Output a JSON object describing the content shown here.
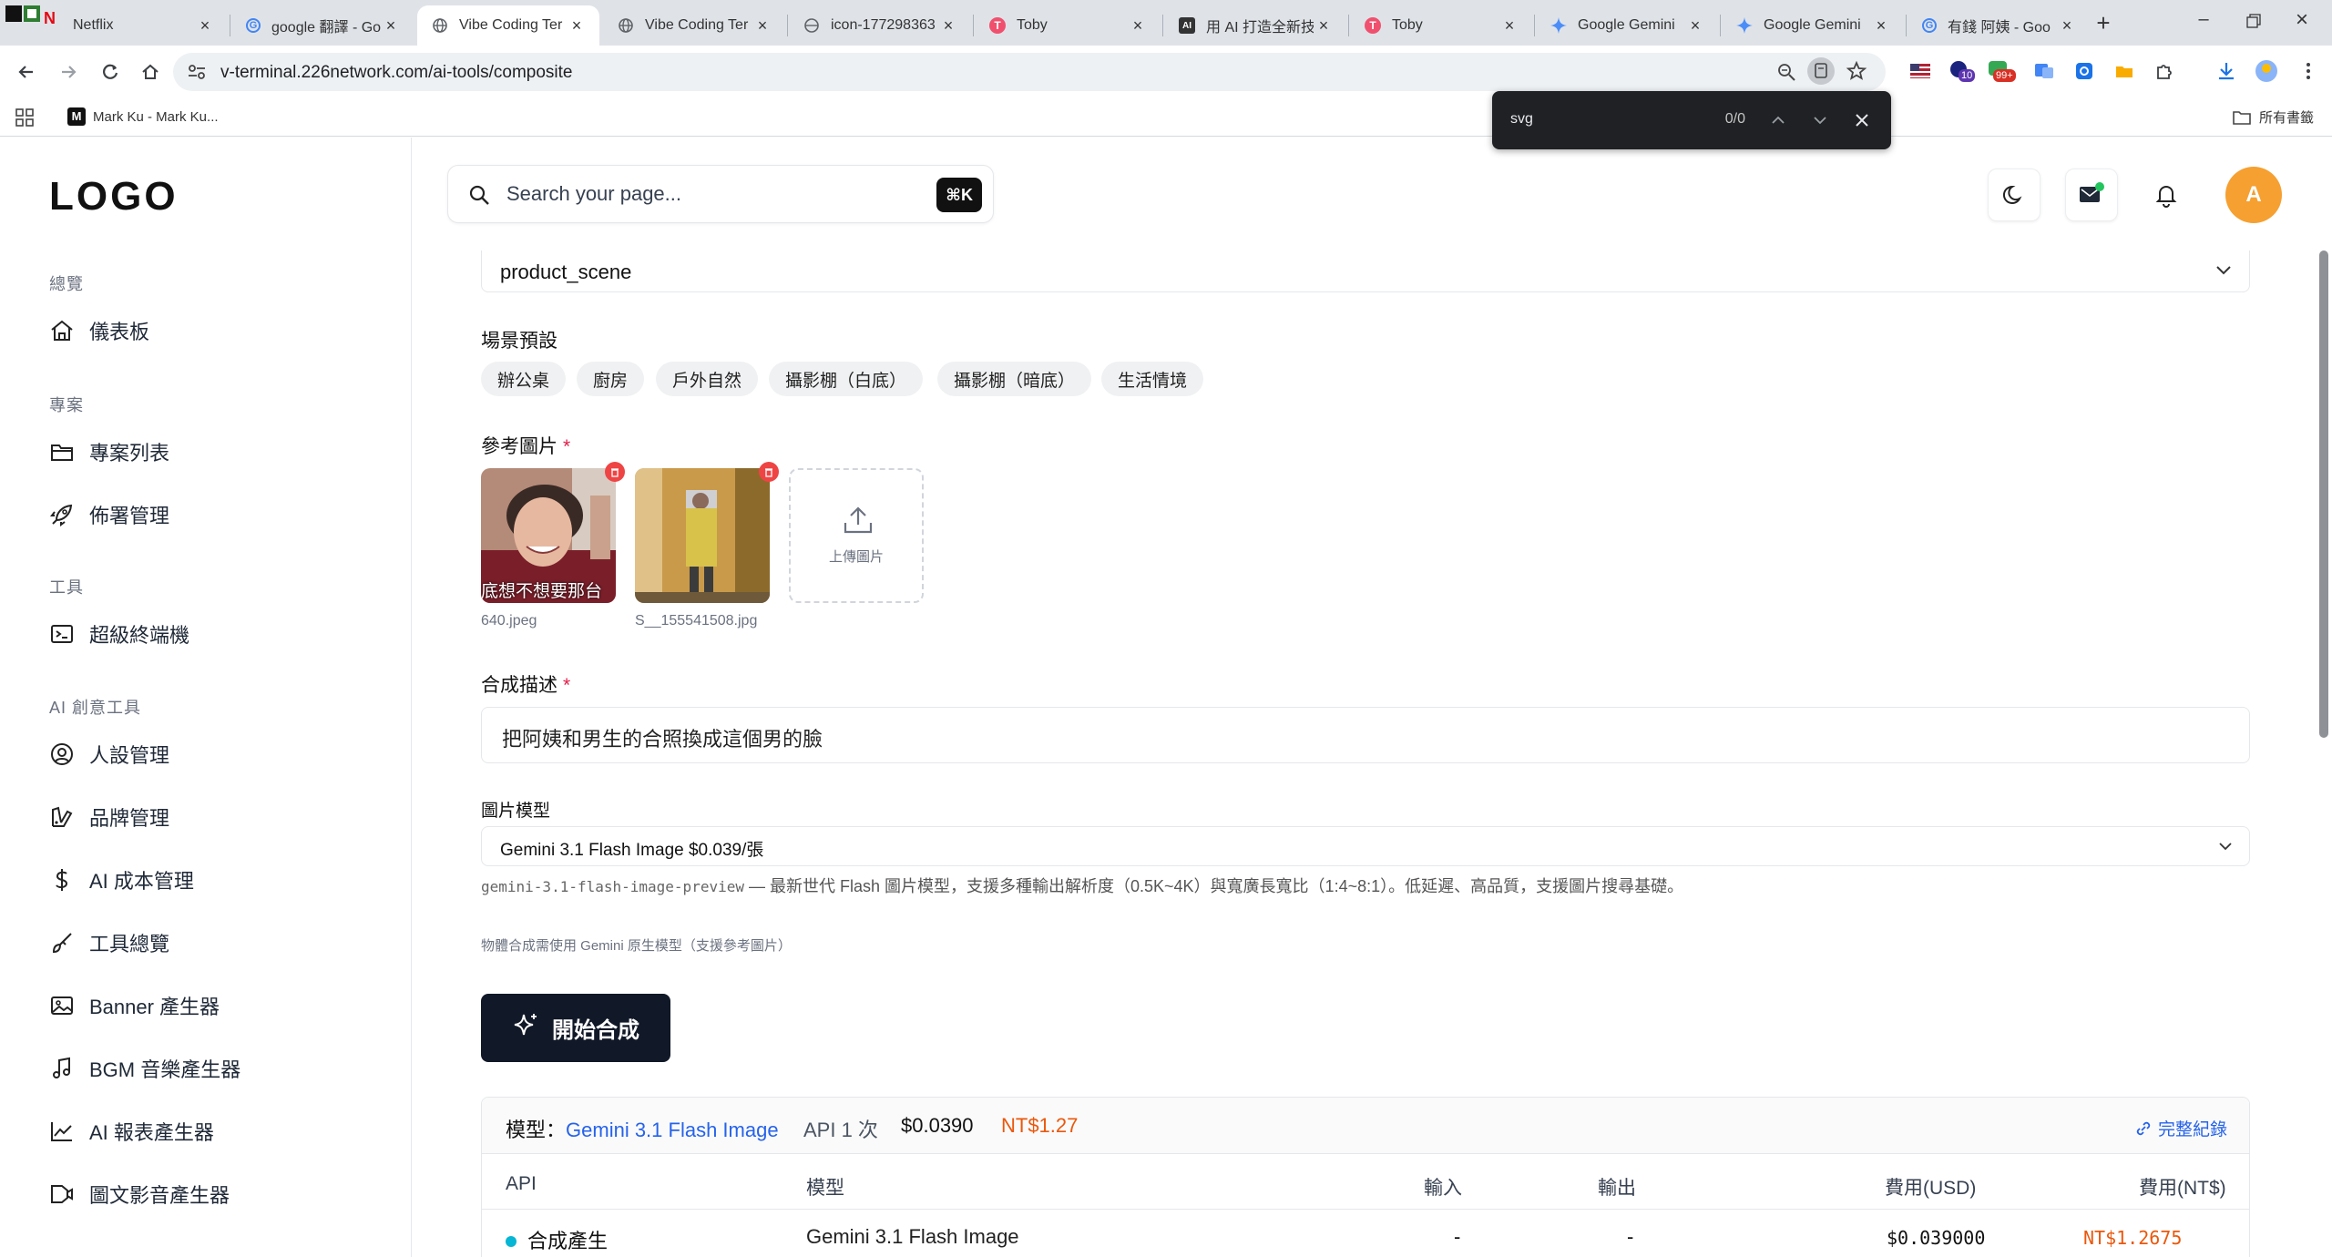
{
  "browser": {
    "tabs": [
      {
        "title": "Netflix",
        "favicon": "netflix-icon",
        "active": false
      },
      {
        "title": "google 翻譯 - Go",
        "favicon": "google-icon",
        "active": false
      },
      {
        "title": "Vibe Coding Ter",
        "favicon": "globe-icon",
        "active": true
      },
      {
        "title": "Vibe Coding Ter",
        "favicon": "globe-icon",
        "active": false
      },
      {
        "title": "icon-177298363",
        "favicon": "globe-icon",
        "active": false
      },
      {
        "title": "Toby",
        "favicon": "toby-icon",
        "active": false
      },
      {
        "title": "用 AI 打造全新技",
        "favicon": "ai-icon",
        "active": false
      },
      {
        "title": "Toby",
        "favicon": "toby-icon",
        "active": false
      },
      {
        "title": "Google Gemini",
        "favicon": "gemini-icon",
        "active": false
      },
      {
        "title": "Google Gemini",
        "favicon": "gemini-icon",
        "active": false
      },
      {
        "title": "有錢 阿姨 - Goo",
        "favicon": "google-icon",
        "active": false
      }
    ],
    "url": "v-terminal.226network.com/ai-tools/composite",
    "bookmarks": {
      "item": "Mark Ku - Mark Ku...",
      "all_bookmarks": "所有書籤"
    },
    "extension_badges": {
      "ext1": "10",
      "ext2": "99+"
    },
    "find": {
      "query": "svg",
      "count": "0/0"
    }
  },
  "sidebar": {
    "logo": "LOGO",
    "sections": [
      {
        "title": "總覽",
        "items": [
          {
            "label": "儀表板",
            "icon": "home-icon"
          }
        ]
      },
      {
        "title": "專案",
        "items": [
          {
            "label": "專案列表",
            "icon": "folder-icon"
          },
          {
            "label": "佈署管理",
            "icon": "rocket-icon"
          }
        ]
      },
      {
        "title": "工具",
        "items": [
          {
            "label": "超級終端機",
            "icon": "terminal-icon"
          }
        ]
      },
      {
        "title": "AI 創意工具",
        "items": [
          {
            "label": "人設管理",
            "icon": "user-circle-icon"
          },
          {
            "label": "品牌管理",
            "icon": "palette-icon"
          },
          {
            "label": "AI 成本管理",
            "icon": "dollar-icon"
          },
          {
            "label": "工具總覽",
            "icon": "brush-icon"
          },
          {
            "label": "Banner 產生器",
            "icon": "image-icon"
          },
          {
            "label": "BGM 音樂產生器",
            "icon": "music-icon"
          },
          {
            "label": "AI 報表產生器",
            "icon": "chart-icon"
          },
          {
            "label": "圖文影音產生器",
            "icon": "video-icon"
          }
        ]
      }
    ]
  },
  "header": {
    "search_placeholder": "Search your page...",
    "search_shortcut": "⌘K",
    "avatar_initial": "A"
  },
  "form": {
    "scene_type_value": "product_scene",
    "scene_presets_label": "場景預設",
    "scene_presets": [
      "辦公桌",
      "廚房",
      "戶外自然",
      "攝影棚（白底）",
      "攝影棚（暗底）",
      "生活情境"
    ],
    "ref_images_label": "參考圖片",
    "required_mark": "*",
    "ref_images": [
      {
        "filename": "640.jpeg",
        "caption": "底想不想要那台"
      },
      {
        "filename": "S__155541508.jpg",
        "caption": ""
      }
    ],
    "upload_label": "上傳圖片",
    "description_label": "合成描述",
    "description_value": "把阿姨和男生的合照換成這個男的臉",
    "model_label": "圖片模型",
    "model_value": "Gemini 3.1 Flash Image $0.039/張",
    "model_id": "gemini-3.1-flash-image-preview",
    "model_desc": " — 最新世代 Flash 圖片模型，支援多種輸出解析度（0.5K~4K）與寬廣長寬比（1:4~8:1）。低延遲、高品質，支援圖片搜尋基礎。",
    "gemini_note": "物體合成需使用 Gemini 原生模型（支援參考圖片）",
    "start_button": "開始合成"
  },
  "cost": {
    "model_prefix": "模型：",
    "model_name": "Gemini 3.1 Flash Image",
    "api_calls": "API 1 次",
    "usd": "$0.0390",
    "twd": "NT$1.27",
    "full_log": "完整紀錄",
    "columns": [
      "API",
      "模型",
      "輸入",
      "輸出",
      "費用(USD)",
      "費用(NT$)"
    ],
    "rows": [
      {
        "api": "合成產生",
        "model": "Gemini 3.1 Flash Image",
        "input": "-",
        "output": "-",
        "usd": "$0.039000",
        "twd": "NT$1.2675"
      }
    ]
  },
  "colors": {
    "accent_blue": "#2563eb",
    "price_orange": "#ea580c",
    "avatar_orange": "#f5a031",
    "status_teal": "#06b6d4",
    "required_red": "#e11d48"
  }
}
